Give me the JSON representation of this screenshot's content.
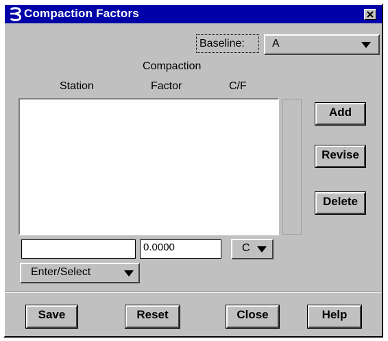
{
  "window": {
    "title": "Compaction Factors",
    "colors": {
      "titlebar": "#0000a8",
      "face": "#c0c0c0"
    },
    "icons": [
      "app-logo-icon",
      "close-icon"
    ]
  },
  "baseline": {
    "label": "Baseline:",
    "value": "A"
  },
  "columns": {
    "station": "Station",
    "factor_top": "Compaction",
    "factor_bottom": "Factor",
    "cf": "C/F"
  },
  "list": {
    "rows": []
  },
  "side_buttons": {
    "add": "Add",
    "revise": "Revise",
    "delete": "Delete"
  },
  "entry": {
    "station_value": "",
    "factor_value": "0.0000",
    "cf_value": "C"
  },
  "mode": {
    "value": "Enter/Select"
  },
  "footer": {
    "save": "Save",
    "reset": "Reset",
    "close": "Close",
    "help": "Help"
  }
}
